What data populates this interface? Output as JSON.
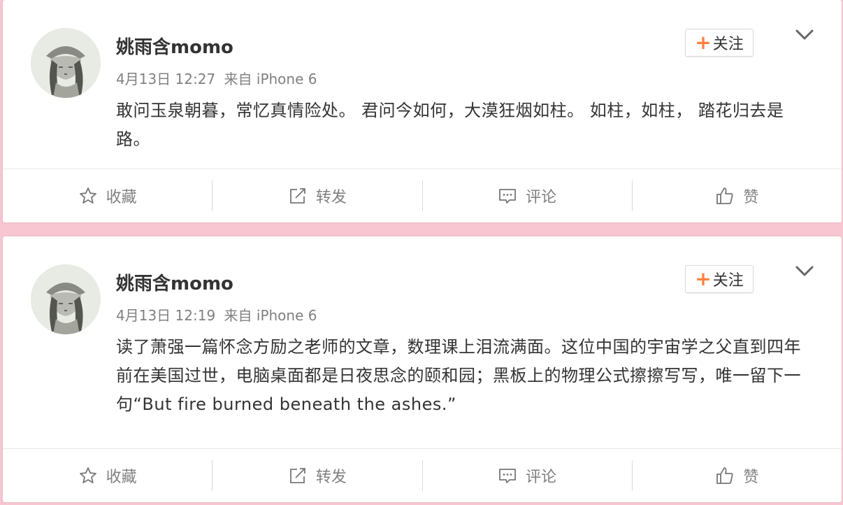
{
  "posts": [
    {
      "username": "姚雨含momo",
      "timestamp": "4月13日 12:27",
      "source_prefix": "来自",
      "source": "iPhone 6",
      "text": "敢问玉泉朝暮，常忆真情险处。 君问今如何，大漠狂烟如柱。 如柱，如柱， 踏花归去是路。",
      "follow_label": "关注",
      "actions": {
        "favorite": "收藏",
        "repost": "转发",
        "comment": "评论",
        "like": "赞"
      }
    },
    {
      "username": "姚雨含momo",
      "timestamp": "4月13日 12:19",
      "source_prefix": "来自",
      "source": "iPhone 6",
      "text": "读了萧强一篇怀念方励之老师的文章，数理课上泪流满面。这位中国的宇宙学之父直到四年前在美国过世，电脑桌面都是日夜思念的颐和园；黑板上的物理公式擦擦写写，唯一留下一句“But fire burned beneath the ashes.”",
      "follow_label": "关注",
      "actions": {
        "favorite": "收藏",
        "repost": "转发",
        "comment": "评论",
        "like": "赞"
      }
    }
  ],
  "colors": {
    "page_background": "#f7c6d1",
    "follow_plus": "#ff8140",
    "meta_text": "#808080"
  },
  "icons": [
    "star-icon",
    "repost-icon",
    "comment-icon",
    "thumbs-up-icon",
    "chevron-down-icon",
    "plus-icon"
  ]
}
